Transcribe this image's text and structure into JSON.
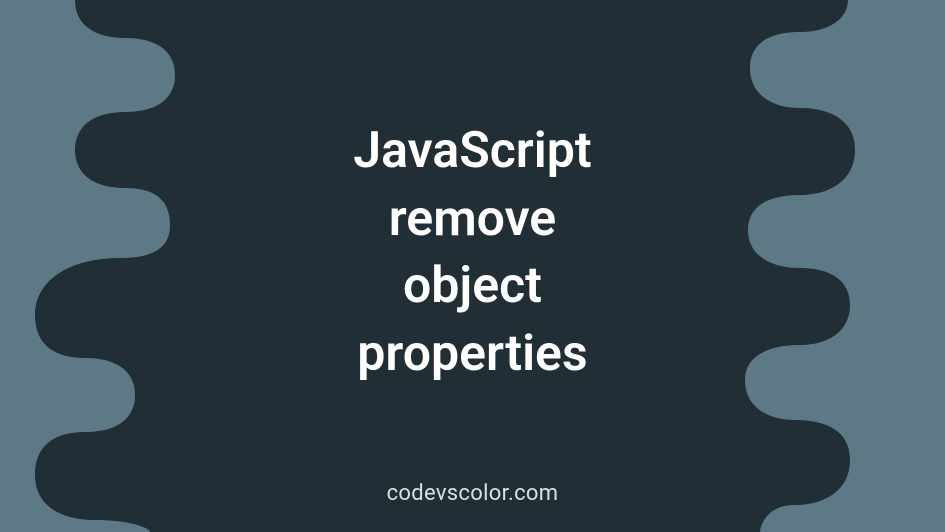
{
  "title": "JavaScript\nremove\nobject\nproperties",
  "attribution": "codevscolor.com",
  "colors": {
    "background": "#5d7986",
    "blob": "#222e35",
    "text": "#ffffff",
    "attribution": "#d9e0e3"
  }
}
